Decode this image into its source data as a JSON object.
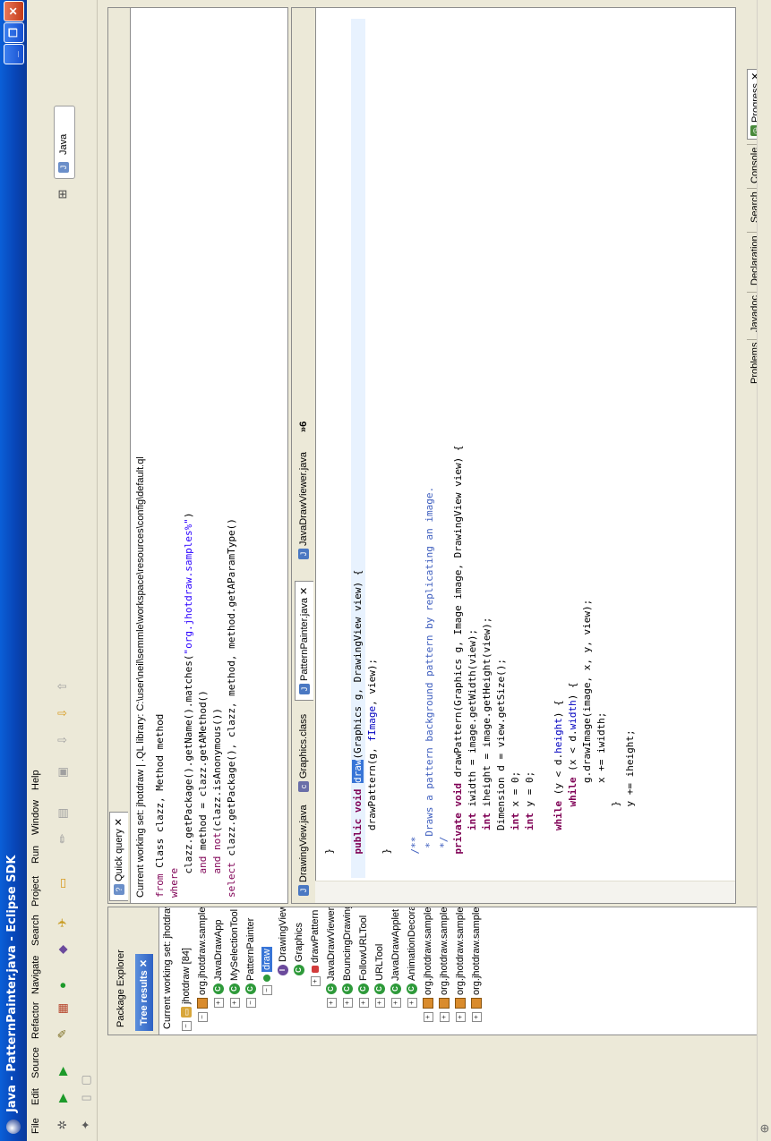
{
  "window": {
    "title": "Java - PatternPainter.java - Eclipse SDK",
    "minimize_glyph": "_",
    "maximize_glyph": "❐",
    "close_glyph": "✕"
  },
  "menu": [
    "File",
    "Edit",
    "Source",
    "Refactor",
    "Navigate",
    "Search",
    "Project",
    "Run",
    "Window",
    "Help"
  ],
  "perspective": {
    "label": "Java"
  },
  "left_panel": {
    "tabs": [
      "Package Explorer",
      "Tree results"
    ],
    "working_set": "Current working set: jhotdraw",
    "tree": [
      {
        "label": "jhotdraw [84]",
        "kind": "project",
        "expander": "⊟"
      },
      {
        "label": "org.jhotdraw.samples.javadraw",
        "kind": "package",
        "expander": "⊟"
      },
      {
        "label": "JavaDrawApp",
        "kind": "class",
        "expander": "⊞"
      },
      {
        "label": "MySelectionTool",
        "kind": "class",
        "expander": "⊞"
      },
      {
        "label": "PatternPainter",
        "kind": "class",
        "expander": "⊟"
      },
      {
        "label": "draw",
        "kind": "method",
        "expander": "⊟"
      },
      {
        "label": "DrawingView",
        "kind": "interface",
        "expander": ""
      },
      {
        "label": "Graphics",
        "kind": "class",
        "expander": ""
      },
      {
        "label": "drawPattern",
        "kind": "private-method",
        "expander": "⊞"
      },
      {
        "label": "JavaDrawViewer",
        "kind": "class",
        "expander": "⊞"
      },
      {
        "label": "BouncingDrawing",
        "kind": "class",
        "expander": "⊞"
      },
      {
        "label": "FollowURLTool",
        "kind": "class",
        "expander": "⊞"
      },
      {
        "label": "URLTool",
        "kind": "class",
        "expander": "⊞"
      },
      {
        "label": "JavaDrawApplet",
        "kind": "class",
        "expander": "⊞"
      },
      {
        "label": "AnimationDecorator",
        "kind": "class",
        "expander": "⊞"
      },
      {
        "label": "org.jhotdraw.samples.minimap",
        "kind": "package",
        "expander": "⊞"
      },
      {
        "label": "org.jhotdraw.samples.net",
        "kind": "package",
        "expander": "⊞"
      },
      {
        "label": "org.jhotdraw.samples.nothing",
        "kind": "package",
        "expander": "⊞"
      },
      {
        "label": "org.jhotdraw.samples.pert",
        "kind": "package",
        "expander": "⊞"
      }
    ]
  },
  "quick_query": {
    "tab": "Quick query",
    "header": "Current working set: jhotdraw  |  .QL library: C:\\user\\neil\\semmle\\workspace\\resources\\config\\default.ql",
    "lines": [
      [
        {
          "t": "from",
          "c": "qkw"
        },
        {
          "t": " Class clazz, Method method",
          "c": ""
        }
      ],
      [
        {
          "t": "where",
          "c": "qkw"
        }
      ],
      [
        {
          "t": "    clazz.getPackage().getName().matches(",
          "c": ""
        },
        {
          "t": "\"org.jhotdraw.samples%\"",
          "c": "str"
        },
        {
          "t": ")",
          "c": ""
        }
      ],
      [
        {
          "t": "    ",
          "c": ""
        },
        {
          "t": "and",
          "c": "qkw"
        },
        {
          "t": " method = clazz.getAMethod()",
          "c": ""
        }
      ],
      [
        {
          "t": "    ",
          "c": ""
        },
        {
          "t": "and not",
          "c": "qkw"
        },
        {
          "t": "(clazz.isAnonymous())",
          "c": ""
        }
      ],
      [
        {
          "t": "select",
          "c": "qkw"
        },
        {
          "t": " clazz.getPackage(), clazz, method, method.getAParamType()",
          "c": ""
        }
      ]
    ]
  },
  "editor": {
    "tabs": [
      "DrawingView.java",
      "Graphics.class",
      "PatternPainter.java",
      "JavaDrawViewer.java",
      "»6"
    ],
    "lines": [
      [
        {
          "t": "    }",
          "c": ""
        }
      ],
      [
        {
          "t": "",
          "c": ""
        }
      ],
      [
        {
          "t": "    ",
          "c": ""
        },
        {
          "t": "public void",
          "c": "kw"
        },
        {
          "t": " ",
          "c": ""
        },
        {
          "t": "draw",
          "c": "selw"
        },
        {
          "t": "(Graphics g, DrawingView view) {",
          "c": ""
        }
      ],
      [
        {
          "t": "        drawPattern(g, ",
          "c": ""
        },
        {
          "t": "fImage",
          "c": "fld"
        },
        {
          "t": ", view);",
          "c": ""
        }
      ],
      [
        {
          "t": "    }",
          "c": ""
        }
      ],
      [
        {
          "t": "",
          "c": ""
        }
      ],
      [
        {
          "t": "    /**",
          "c": "cm"
        }
      ],
      [
        {
          "t": "     * Draws a pattern background pattern by replicating an image.",
          "c": "cm"
        }
      ],
      [
        {
          "t": "     */",
          "c": "cm"
        }
      ],
      [
        {
          "t": "    ",
          "c": ""
        },
        {
          "t": "private void",
          "c": "kw"
        },
        {
          "t": " drawPattern(Graphics g, Image image, DrawingView view) {",
          "c": ""
        }
      ],
      [
        {
          "t": "        ",
          "c": ""
        },
        {
          "t": "int",
          "c": "kw"
        },
        {
          "t": " iwidth = image.getWidth(view);",
          "c": ""
        }
      ],
      [
        {
          "t": "        ",
          "c": ""
        },
        {
          "t": "int",
          "c": "kw"
        },
        {
          "t": " iheight = image.getHeight(view);",
          "c": ""
        }
      ],
      [
        {
          "t": "        Dimension d = view.getSize();",
          "c": ""
        }
      ],
      [
        {
          "t": "        ",
          "c": ""
        },
        {
          "t": "int",
          "c": "kw"
        },
        {
          "t": " x = 0;",
          "c": ""
        }
      ],
      [
        {
          "t": "        ",
          "c": ""
        },
        {
          "t": "int",
          "c": "kw"
        },
        {
          "t": " y = 0;",
          "c": ""
        }
      ],
      [
        {
          "t": "",
          "c": ""
        }
      ],
      [
        {
          "t": "        ",
          "c": ""
        },
        {
          "t": "while",
          "c": "kw"
        },
        {
          "t": " (y < d.",
          "c": ""
        },
        {
          "t": "height",
          "c": "fld"
        },
        {
          "t": ") {",
          "c": ""
        }
      ],
      [
        {
          "t": "            ",
          "c": ""
        },
        {
          "t": "while",
          "c": "kw"
        },
        {
          "t": " (x < d.",
          "c": ""
        },
        {
          "t": "width",
          "c": "fld"
        },
        {
          "t": ") {",
          "c": ""
        }
      ],
      [
        {
          "t": "                g.drawImage(image, x, y, view);",
          "c": ""
        }
      ],
      [
        {
          "t": "                x += iwidth;",
          "c": ""
        }
      ],
      [
        {
          "t": "            }",
          "c": ""
        }
      ],
      [
        {
          "t": "            y += iheight;",
          "c": ""
        }
      ]
    ]
  },
  "bottom_tabs": [
    "Problems",
    "Javadoc",
    "Declaration",
    "Search",
    "Console",
    "Progress"
  ],
  "colors": {
    "accent": "#3875d7",
    "titlebar": "#0a5fd8"
  }
}
